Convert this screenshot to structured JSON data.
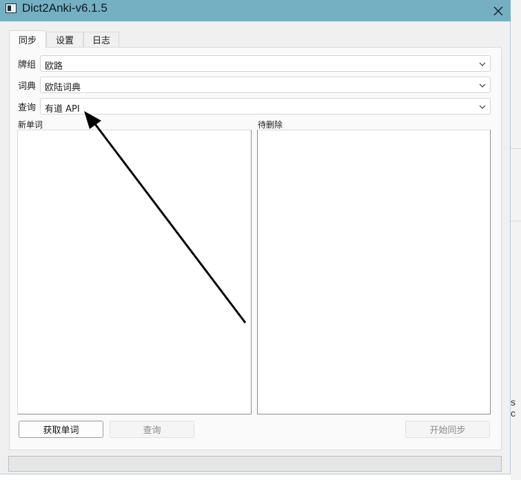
{
  "window": {
    "title": "Dict2Anki-v6.1.5",
    "app_icon": "window-app-icon",
    "close_icon": "close-icon"
  },
  "tabs": [
    {
      "label": "同步",
      "active": true
    },
    {
      "label": "设置",
      "active": false
    },
    {
      "label": "日志",
      "active": false
    }
  ],
  "form": {
    "deck": {
      "label": "牌组",
      "value": "欧路"
    },
    "dictionary": {
      "label": "词典",
      "value": "欧陆词典"
    },
    "query": {
      "label": "查询",
      "value": "有道 API"
    }
  },
  "lists": {
    "new_words": {
      "label": "新单词",
      "items": []
    },
    "to_delete": {
      "label": "待删除",
      "items": []
    }
  },
  "buttons": {
    "fetch_words": {
      "label": "获取单词",
      "enabled": true
    },
    "query": {
      "label": "查询",
      "enabled": false
    },
    "start_sync": {
      "label": "开始同步",
      "enabled": false
    }
  },
  "progress": {
    "value": 0
  },
  "colors": {
    "titlebar": "#74afc2",
    "panel": "#fafafa",
    "window": "#f0f0f0",
    "annotation_arrow": "#000000"
  }
}
